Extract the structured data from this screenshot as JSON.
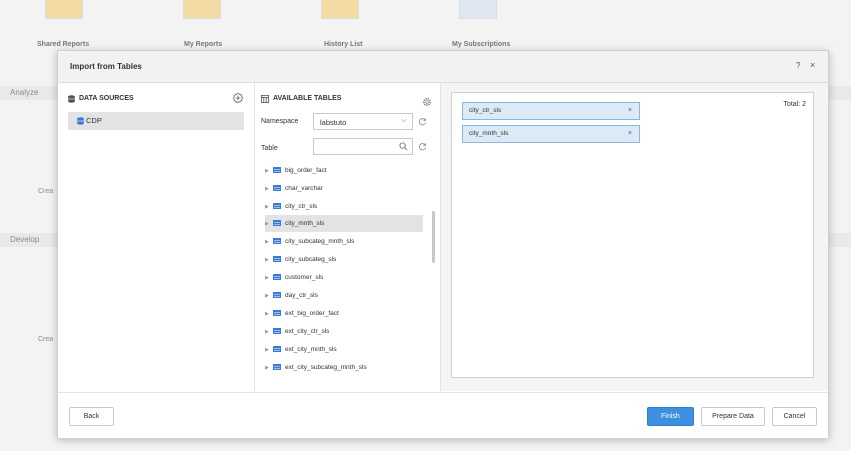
{
  "background": {
    "tiles": [
      {
        "label": "Shared Reports",
        "icon": "shared-reports-icon"
      },
      {
        "label": "My Reports",
        "icon": "my-reports-icon"
      },
      {
        "label": "History List",
        "icon": "history-list-icon"
      },
      {
        "label": "My Subscriptions",
        "icon": "my-subscriptions-icon"
      }
    ],
    "sections": [
      "Analyze",
      "Develop"
    ],
    "create_labels": [
      "Crea",
      "Crea"
    ]
  },
  "dialog": {
    "title": "Import from Tables",
    "help": "?",
    "close": "×"
  },
  "data_sources": {
    "title": "DATA SOURCES",
    "add_icon": "plus-circle-icon",
    "items": [
      {
        "label": "CDP",
        "selected": true
      }
    ]
  },
  "available_tables": {
    "title": "AVAILABLE TABLES",
    "namespace_label": "Namespace",
    "namespace_value": "labstuto",
    "table_label": "Table",
    "table_search_value": "",
    "tables": [
      {
        "name": "big_order_fact",
        "selected": false
      },
      {
        "name": "char_varchar",
        "selected": false
      },
      {
        "name": "city_ctr_sls",
        "selected": false
      },
      {
        "name": "city_mnth_sls",
        "selected": true
      },
      {
        "name": "city_subcateg_mnth_sls",
        "selected": false
      },
      {
        "name": "city_subcateg_sls",
        "selected": false
      },
      {
        "name": "customer_sls",
        "selected": false
      },
      {
        "name": "day_ctr_sls",
        "selected": false
      },
      {
        "name": "ext_big_order_fact",
        "selected": false
      },
      {
        "name": "ext_city_ctr_sls",
        "selected": false
      },
      {
        "name": "ext_city_mnth_sls",
        "selected": false
      },
      {
        "name": "ext_city_subcateg_mnth_sls",
        "selected": false
      }
    ]
  },
  "selected_tables": {
    "total": "Total: 2",
    "items": [
      {
        "name": "city_ctr_sls",
        "remove": "×"
      },
      {
        "name": "city_mnth_sls",
        "remove": "×"
      }
    ]
  },
  "footer": {
    "back": "Back",
    "finish": "Finish",
    "prepare": "Prepare Data",
    "cancel": "Cancel"
  },
  "colors": {
    "accent": "#3d8fe0",
    "chip_bg": "#dceaf7",
    "chip_border": "#8bb6df",
    "db_blue": "#3a7bd5"
  }
}
